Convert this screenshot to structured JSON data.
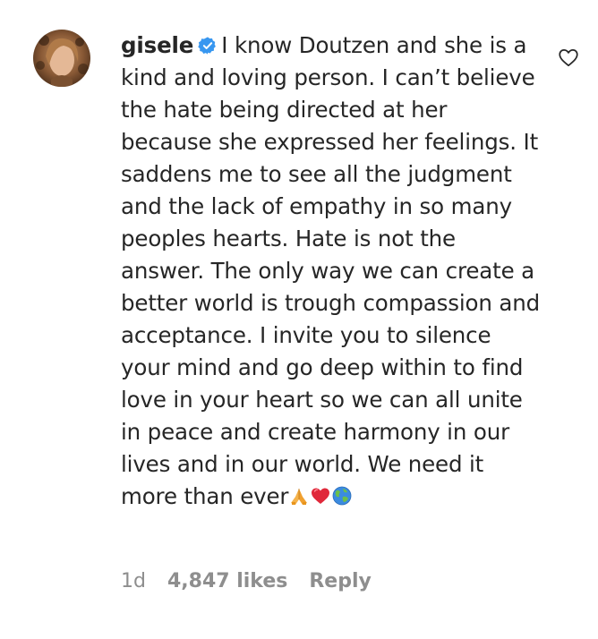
{
  "comment": {
    "username": "gisele",
    "verified": true,
    "text": "I know Doutzen and she is a kind and loving person. I can’t believe the hate being directed at her because she expressed her feelings. It saddens me to see all the judgment and the lack of empathy in so many peoples hearts. Hate is not the answer. The only way we can create a better world is trough compassion and acceptance. I invite you to silence your mind and go deep within to find love in your heart so we can all unite in peace and create harmony in our lives and in our world. We need it more than ever",
    "emojis": [
      "folded-hands-emoji",
      "red-heart-emoji",
      "globe-emoji"
    ],
    "timestamp": "1d",
    "likes": "4,847 likes",
    "reply_label": "Reply"
  },
  "icons": {
    "verified": "verified-badge-icon",
    "like": "heart-outline-icon"
  },
  "colors": {
    "text": "#262626",
    "muted": "#8e8e8e",
    "verified_blue": "#3897f0",
    "background": "#ffffff"
  }
}
